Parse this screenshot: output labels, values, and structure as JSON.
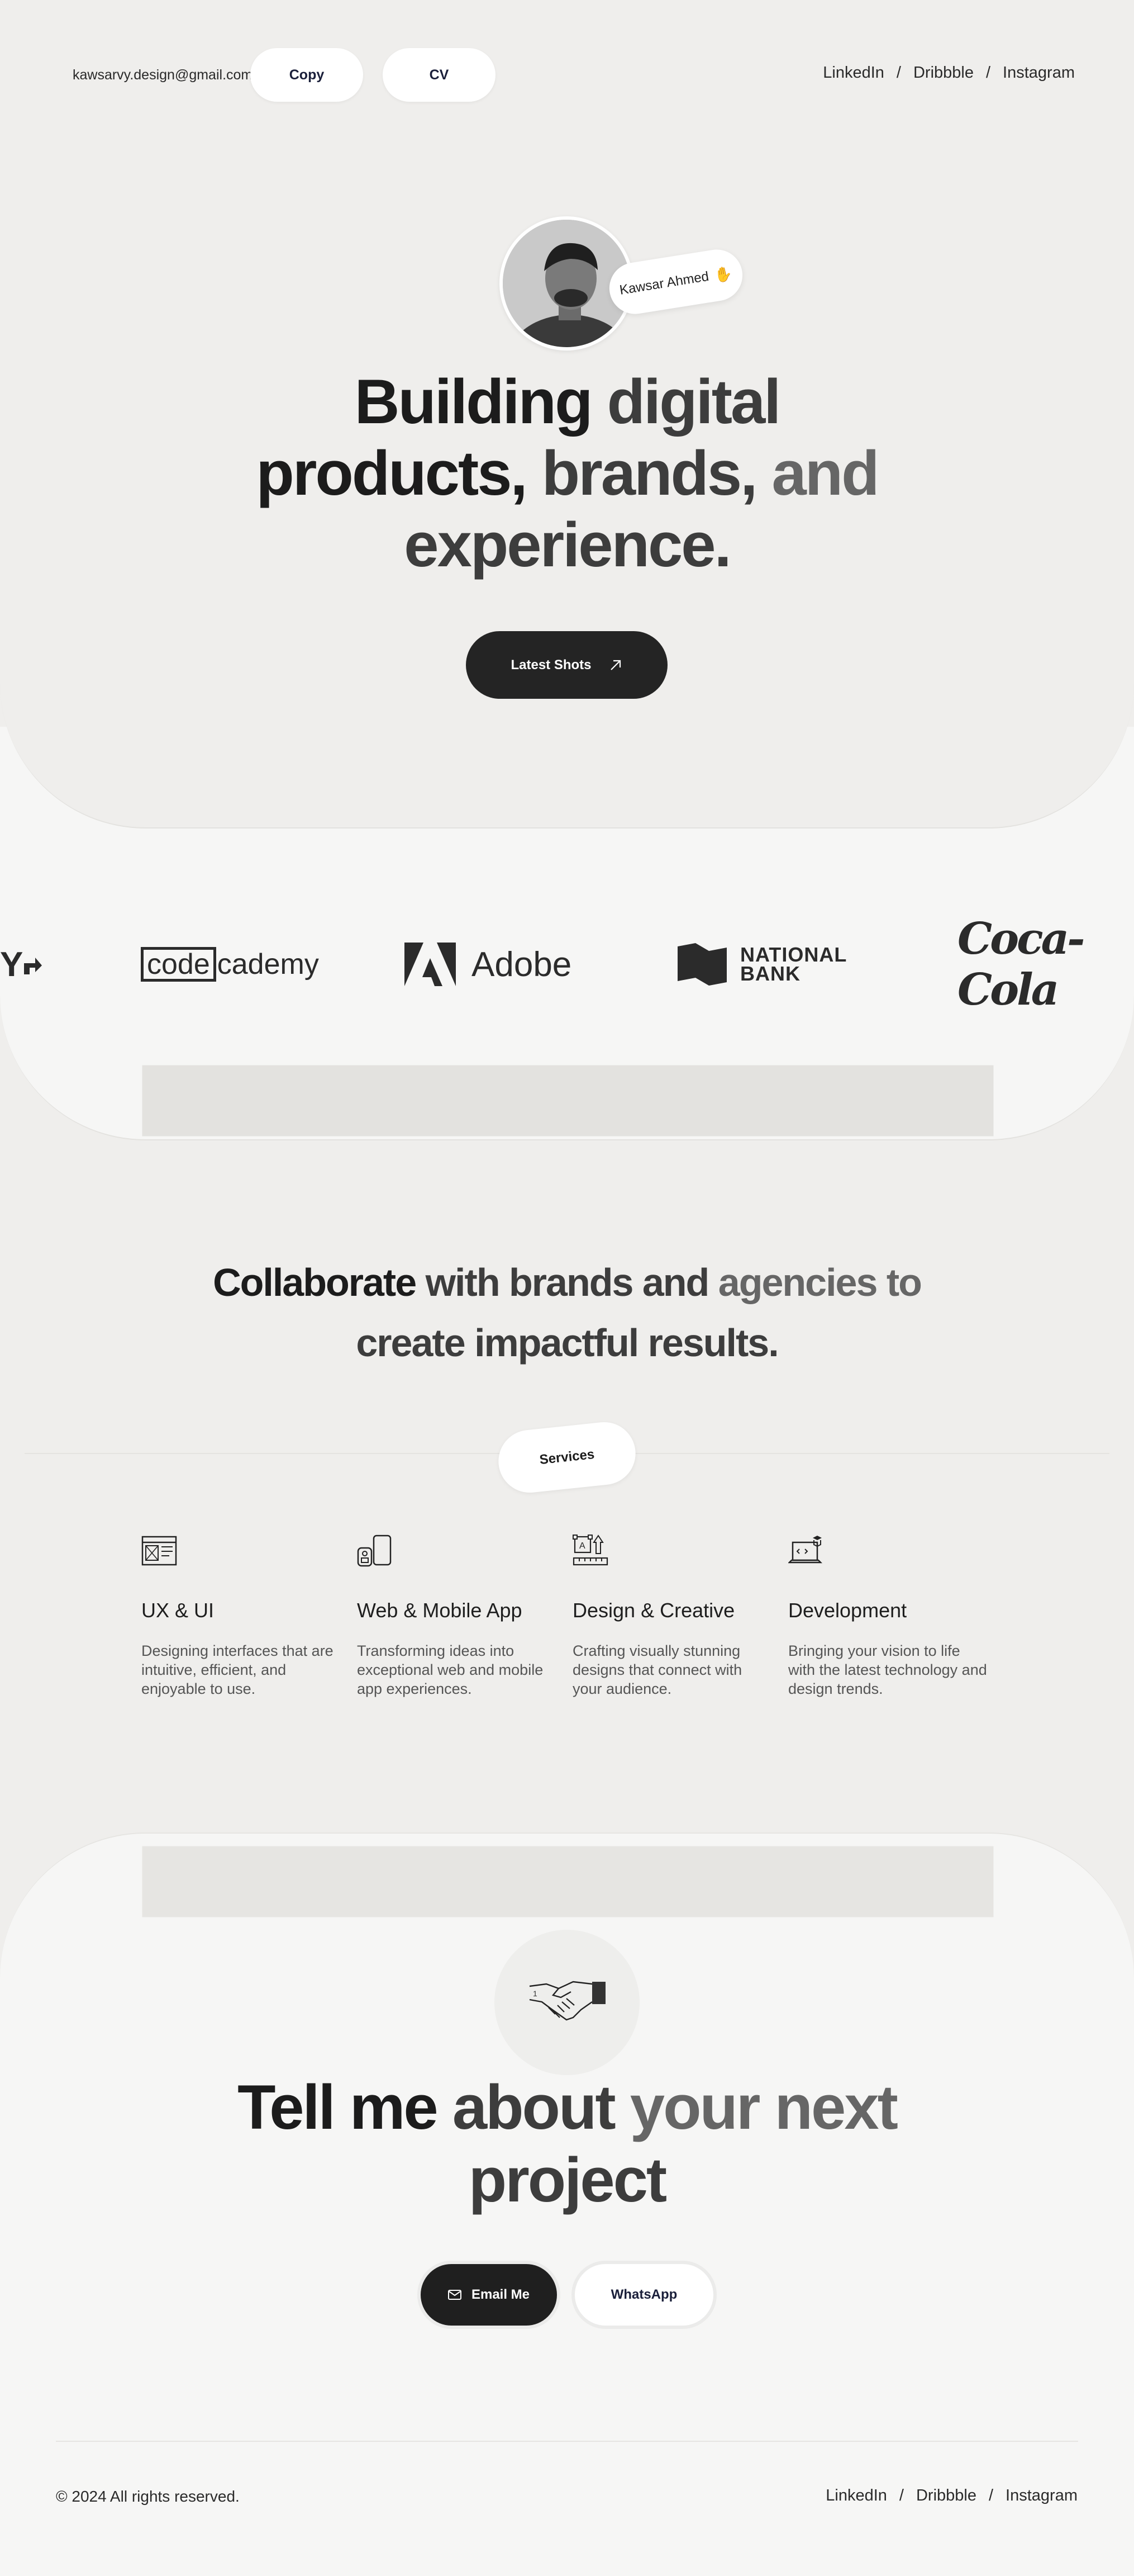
{
  "header": {
    "email": "kawsarvy.design@gmail.com",
    "copy_label": "Copy",
    "cv_label": "CV",
    "nav": [
      "LinkedIn",
      "Dribbble",
      "Instagram"
    ],
    "separator": "/"
  },
  "hero": {
    "name": "Kawsar Ahmed",
    "wave_icon": "waving-hand-icon",
    "headline_line1_a": "Building",
    "headline_line1_b": "digital",
    "headline_line2_a": "products,",
    "headline_line2_b": "brands,",
    "headline_line2_c": "and",
    "headline_line3": "experience.",
    "cta_label": "Latest Shots"
  },
  "logos": {
    "partial": "Y",
    "codecademy_box": "code",
    "codecademy_rest": "cademy",
    "adobe": "Adobe",
    "national_line1": "NATIONAL",
    "national_line2": "BANK",
    "cocacola": "Coca-Cola"
  },
  "collaborate": {
    "line1_a": "Collaborate",
    "line1_b": "with brands and",
    "line1_c": "agencies to",
    "line2": "create impactful results.",
    "tag": "Services"
  },
  "services": [
    {
      "title": "UX & UI",
      "desc": "Designing interfaces that are intuitive, efficient, and enjoyable to use.",
      "icon": "ux-wireframe-icon"
    },
    {
      "title": "Web & Mobile App",
      "desc": "Transforming ideas into exceptional web and mobile app experiences.",
      "icon": "mobile-devices-icon"
    },
    {
      "title": "Design & Creative",
      "desc": "Crafting visually stunning designs that connect with your audience.",
      "icon": "design-tools-icon"
    },
    {
      "title": "Development",
      "desc": "Bringing your vision to life with the latest technology and design trends.",
      "icon": "laptop-code-icon"
    }
  ],
  "contact": {
    "handshake_icon": "handshake-icon",
    "headline_a": "Tell me",
    "headline_b": "about",
    "headline_c": "your next",
    "headline_line2": "project",
    "email_label": "Email Me",
    "whatsapp_label": "WhatsApp"
  },
  "footer": {
    "copyright": "© 2024 All rights reserved.",
    "nav": [
      "LinkedIn",
      "Dribbble",
      "Instagram"
    ],
    "separator": "/"
  },
  "colors": {
    "background": "#efeeec",
    "panel": "#f6f6f5",
    "dark_button": "#242424",
    "text": "#1e1e1e"
  }
}
